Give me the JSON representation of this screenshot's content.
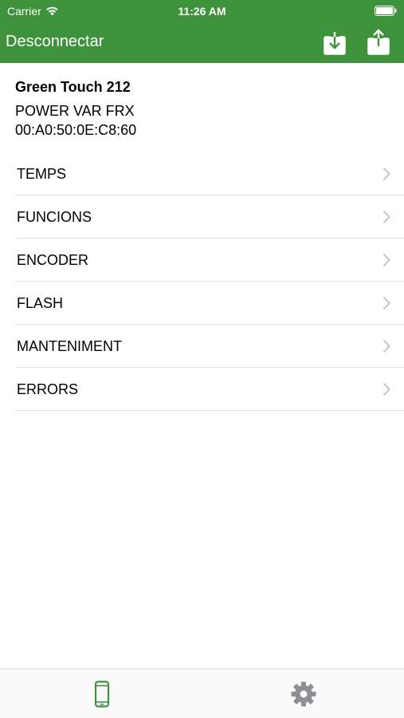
{
  "status_bar": {
    "carrier": "Carrier",
    "time": "11:26 AM"
  },
  "nav": {
    "title": "Desconnectar",
    "download_icon": "download-icon",
    "share_icon": "share-icon",
    "background_color": "#3e923c"
  },
  "device": {
    "name": "Green Touch 212",
    "model": "POWER VAR FRX",
    "mac": "00:A0:50:0E:C8:60"
  },
  "menu": {
    "items": [
      {
        "label": "TEMPS"
      },
      {
        "label": "FUNCIONS"
      },
      {
        "label": "ENCODER"
      },
      {
        "label": "FLASH"
      },
      {
        "label": "MANTENIMENT"
      },
      {
        "label": "ERRORS"
      }
    ],
    "chevron_icon": "chevron-right-icon"
  },
  "tab_bar": {
    "tabs": [
      {
        "icon": "phone-icon",
        "selected": true,
        "color": "#3e923c"
      },
      {
        "icon": "gear-icon",
        "selected": false,
        "color": "#8e8e93"
      }
    ]
  }
}
